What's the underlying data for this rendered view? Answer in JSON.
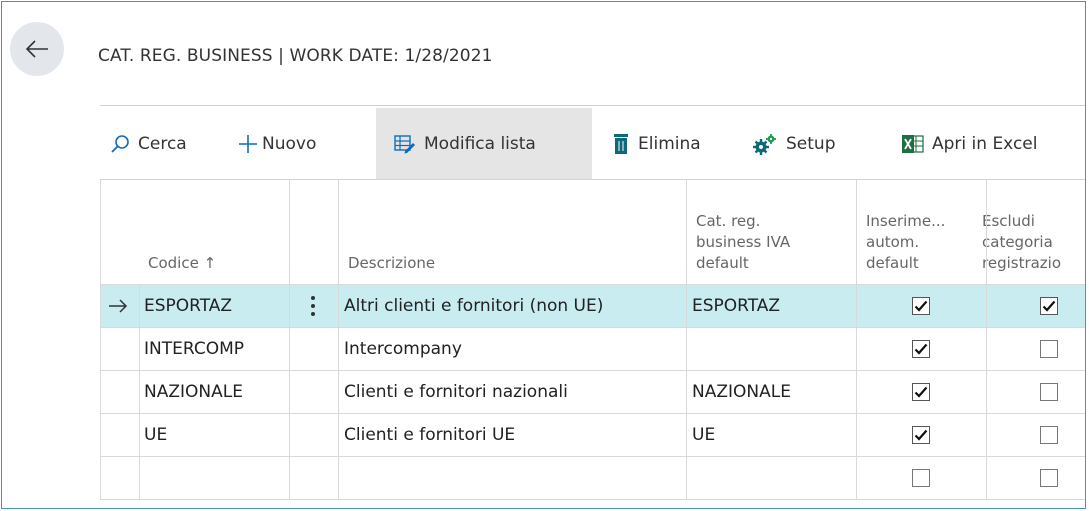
{
  "header": {
    "title": "CAT. REG. BUSINESS | WORK DATE: 1/28/2021"
  },
  "toolbar": {
    "search": "Cerca",
    "new": "Nuovo",
    "edit_list": "Modifica lista",
    "delete": "Elimina",
    "setup": "Setup",
    "open_excel": "Apri in Excel"
  },
  "table": {
    "columns": {
      "code": "Codice ↑",
      "description": "Descrizione",
      "vat_l1": "Cat. reg.",
      "vat_l2": "business IVA",
      "vat_l3": "default",
      "auto_l1": "Inserime...",
      "auto_l2": "autom.",
      "auto_l3": "default",
      "excl_l1": "Escludi",
      "excl_l2": "categoria",
      "excl_l3": "registrazio"
    },
    "rows": [
      {
        "code": "ESPORTAZ",
        "description": "Altri clienti e fornitori (non UE)",
        "vat_default": "ESPORTAZ",
        "auto_insert": true,
        "exclude": true,
        "selected": true
      },
      {
        "code": "INTERCOMP",
        "description": "Intercompany",
        "vat_default": "",
        "auto_insert": true,
        "exclude": false
      },
      {
        "code": "NAZIONALE",
        "description": "Clienti e fornitori nazionali",
        "vat_default": "NAZIONALE",
        "auto_insert": true,
        "exclude": false
      },
      {
        "code": "UE",
        "description": "Clienti e fornitori UE",
        "vat_default": "UE",
        "auto_insert": true,
        "exclude": false
      },
      {
        "code": "",
        "description": "",
        "vat_default": "",
        "auto_insert": false,
        "exclude": false
      }
    ]
  },
  "colors": {
    "selected_row": "#c9ecf0",
    "frame_border": "#4a8fd6",
    "excel_green": "#1d6f42",
    "delete_teal": "#0b6a79"
  }
}
